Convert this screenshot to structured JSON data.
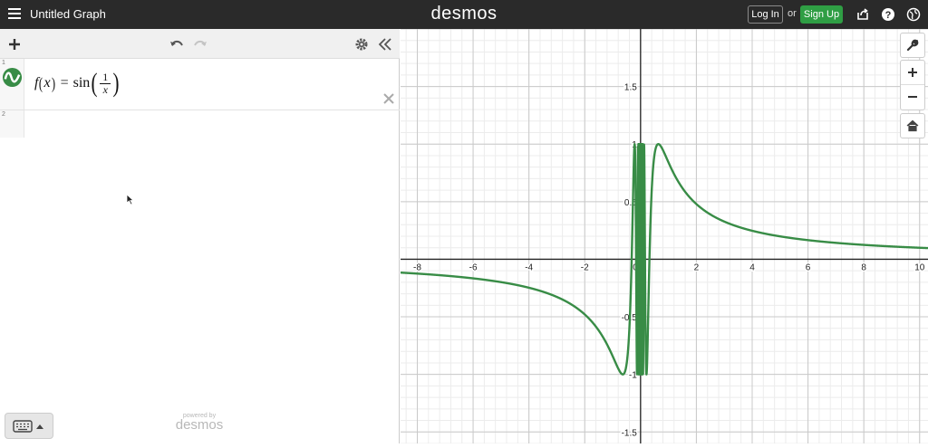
{
  "header": {
    "title": "Untitled Graph",
    "brand": "desmos",
    "login_label": "Log In",
    "or_label": "or",
    "signup_label": "Sign Up",
    "icons": [
      "menu-icon",
      "share-icon",
      "help-icon",
      "globe-icon"
    ],
    "signup_color": "#2f9e44"
  },
  "expression_panel": {
    "toolbar_icons": [
      "add-icon",
      "undo-icon",
      "redo-icon",
      "gear-icon",
      "collapse-icon"
    ],
    "expressions": [
      {
        "index": "1",
        "latex": "f(x)=sin(1/x)",
        "lhs_func": "f",
        "lhs_var": "x",
        "equals": "=",
        "fn": "sin",
        "num": "1",
        "den": "x",
        "color": "#388c46"
      },
      {
        "index": "2",
        "latex": ""
      }
    ],
    "footer": {
      "powered_by": "powered by",
      "brand": "desmos",
      "keyboard_icon": "keyboard-icon"
    }
  },
  "graph": {
    "x_ticks": [
      "-8",
      "-6",
      "-4",
      "-2",
      "0",
      "2",
      "4",
      "6",
      "8",
      "10"
    ],
    "y_ticks": [
      "1.5",
      "1",
      "0.5",
      "-0.5",
      "-1",
      "-1.5"
    ],
    "side_icons": [
      "wrench-icon",
      "zoom-in-icon",
      "zoom-out-icon",
      "home-icon"
    ],
    "curve_color": "#388c46"
  },
  "chart_data": {
    "type": "line",
    "title": "",
    "xlabel": "",
    "ylabel": "",
    "xlim": [
      -8.6,
      10.3
    ],
    "ylim": [
      -1.6,
      2.0
    ],
    "grid": true,
    "series": [
      {
        "name": "f(x)=sin(1/x)",
        "function": "sin(1/x)",
        "color": "#388c46"
      }
    ]
  }
}
